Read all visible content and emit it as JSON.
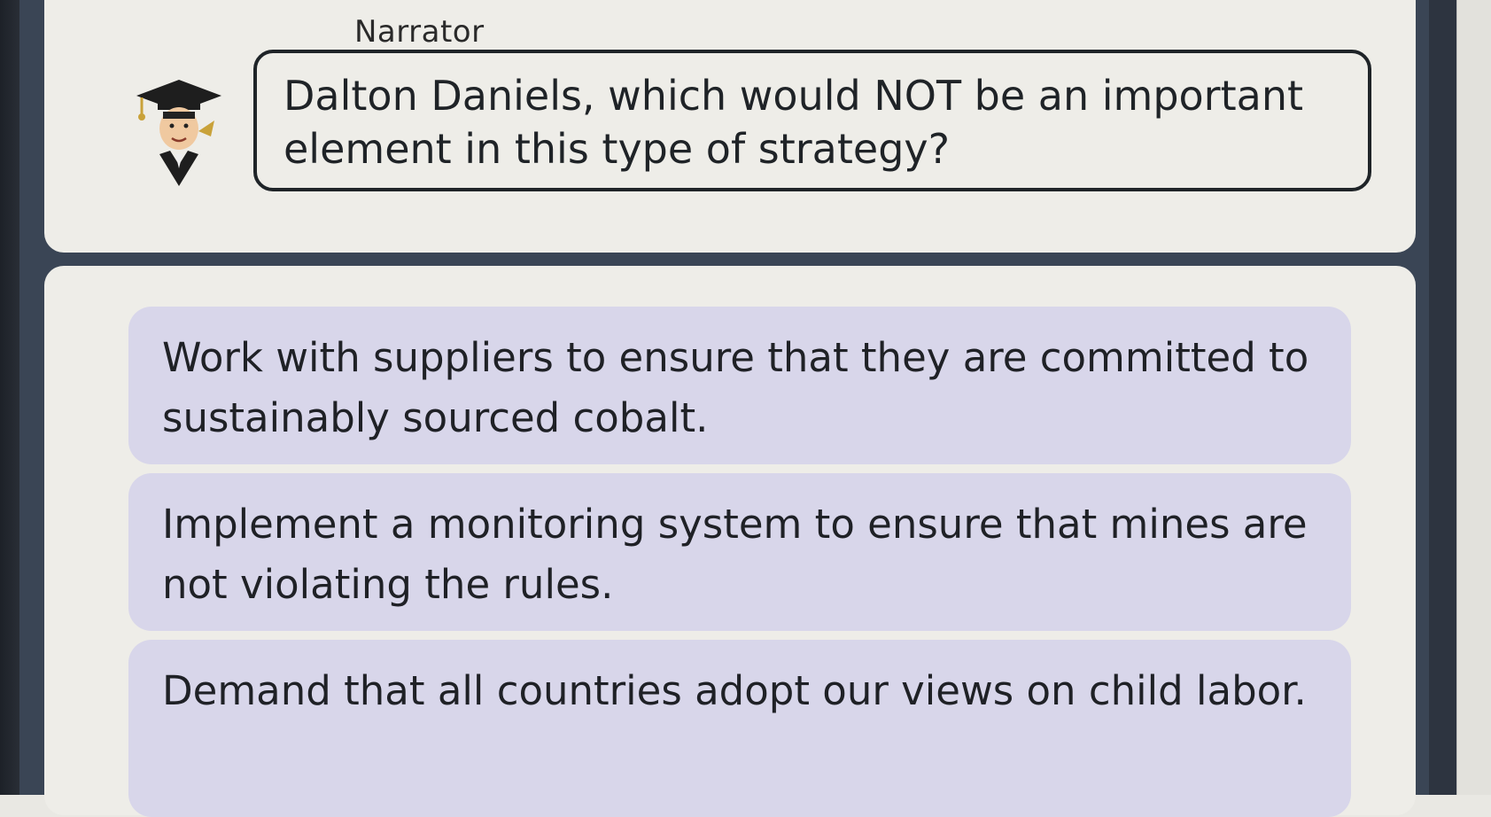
{
  "narrator": {
    "speaker_name": "Narrator",
    "avatar_icon": "graduate-cap-avatar-icon",
    "question": "Dalton Daniels, which would NOT be an important element in this type of strategy?"
  },
  "choices": [
    {
      "label": "Work with suppliers to ensure that they are committed to sustainably sourced cobalt."
    },
    {
      "label": "Implement a monitoring system to ensure that mines are not violating the rules."
    },
    {
      "label": "Demand that all countries adopt our views on child labor."
    }
  ],
  "colors": {
    "choice_background": "#d8d6ea",
    "card_background": "#eeede8",
    "frame": "#3a4555",
    "bubble_border": "#1f2428"
  }
}
